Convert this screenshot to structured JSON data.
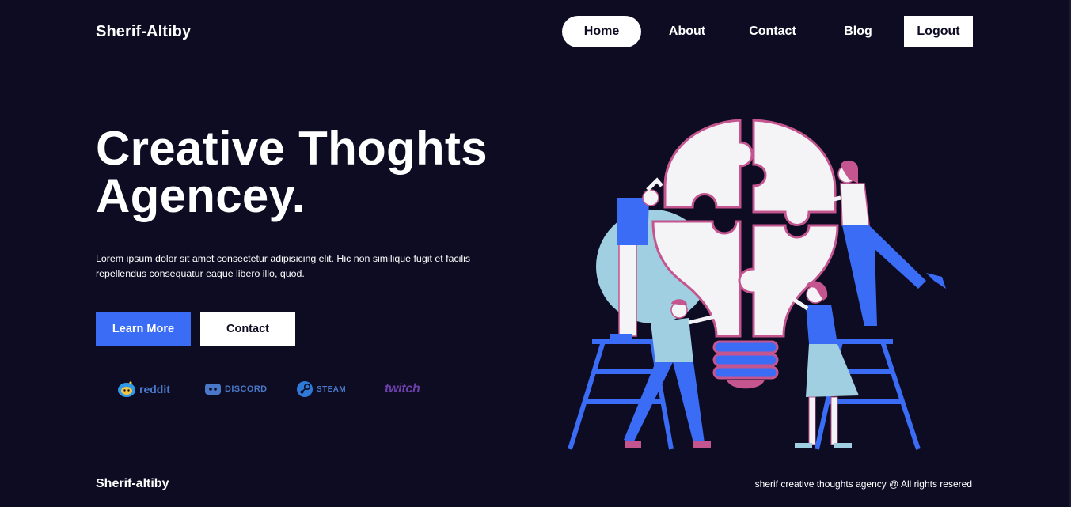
{
  "header": {
    "logo": "Sherif-Altiby",
    "nav": {
      "home": "Home",
      "about": "About",
      "contact": "Contact",
      "blog": "Blog",
      "logout": "Logout"
    }
  },
  "hero": {
    "title_line1": "Creative Thoghts",
    "title_line2": "Agencey.",
    "description": "Lorem ipsum dolor sit amet consectetur adipisicing elit. Hic non similique fugit et facilis repellendus consequatur eaque libero illo, quod.",
    "learn_more": "Learn More",
    "contact": "Contact"
  },
  "partners": [
    {
      "name": "reddit",
      "icon": "reddit-icon"
    },
    {
      "name": "discord",
      "icon": "discord-icon"
    },
    {
      "name": "steam",
      "icon": "steam-icon"
    },
    {
      "name": "twitch",
      "icon": "twitch-icon"
    }
  ],
  "footer": {
    "brand": "Sherif-altiby",
    "copyright": "sherif creative thoughts agency @ All rights resered"
  },
  "colors": {
    "background": "#0d0c22",
    "accent_blue": "#3b6cf5",
    "puzzle_outline": "#c4558f",
    "light_blue": "#9fcfe0"
  }
}
